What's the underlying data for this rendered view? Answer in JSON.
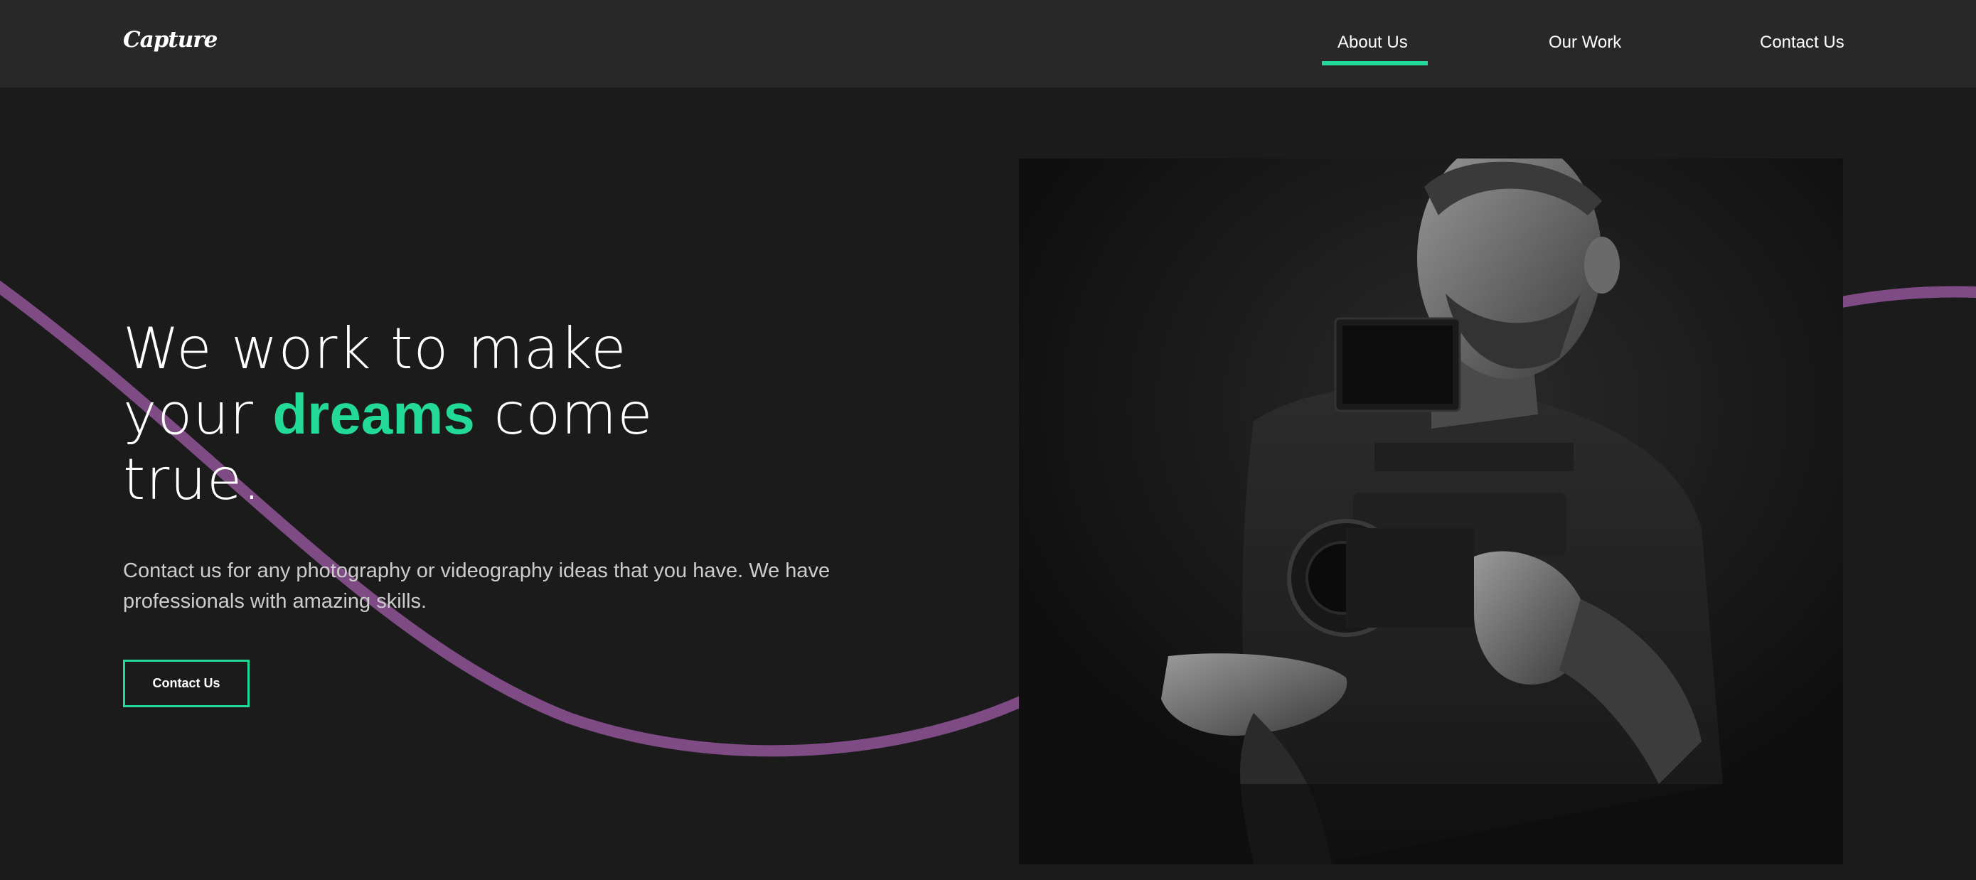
{
  "brand": {
    "logo": "Capture"
  },
  "nav": {
    "items": [
      {
        "label": "About Us",
        "active": true
      },
      {
        "label": "Our Work",
        "active": false
      },
      {
        "label": "Contact Us",
        "active": false
      }
    ]
  },
  "hero": {
    "title_line1": "We work to make",
    "title_line2_pre": "your ",
    "title_accent": "dreams",
    "title_line2_post": " come",
    "title_line3": "true.",
    "description": "Contact us for any photography or videography ideas that you have. We have professionals with amazing skills.",
    "cta_label": "Contact Us",
    "image_alt_icon": "photographer-image"
  },
  "colors": {
    "accent": "#23d997",
    "wave": "#7f4b85",
    "background": "#1b1b1b",
    "navbar": "#282828"
  }
}
